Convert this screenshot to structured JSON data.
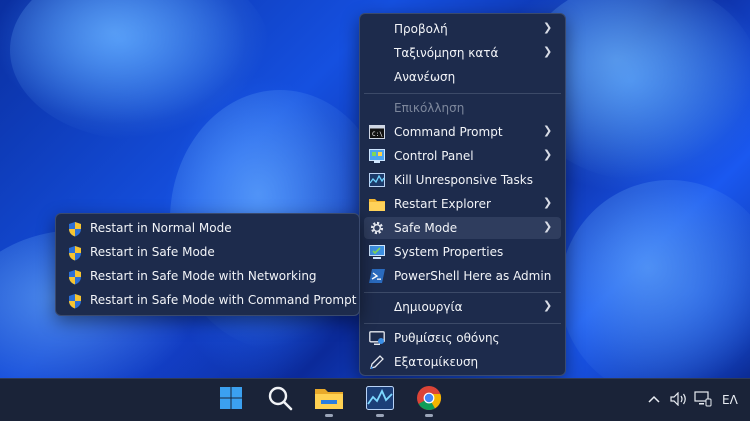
{
  "context_menu": {
    "items": [
      {
        "label": "Προβολή",
        "icon": "none",
        "submenu": true
      },
      {
        "label": "Ταξινόμηση κατά",
        "icon": "none",
        "submenu": true
      },
      {
        "label": "Ανανέωση",
        "icon": "none",
        "submenu": false
      },
      {
        "label": "Επικόλληση",
        "icon": "none",
        "submenu": false,
        "disabled": true
      },
      {
        "label": "Command Prompt",
        "icon": "cmd-icon",
        "submenu": true
      },
      {
        "label": "Control Panel",
        "icon": "control-panel-icon",
        "submenu": true
      },
      {
        "label": "Kill Unresponsive Tasks",
        "icon": "task-manager-icon",
        "submenu": false
      },
      {
        "label": "Restart Explorer",
        "icon": "folder-icon",
        "submenu": true
      },
      {
        "label": "Safe Mode",
        "icon": "gear-icon",
        "submenu": true,
        "highlighted": true
      },
      {
        "label": "System Properties",
        "icon": "system-properties-icon",
        "submenu": false
      },
      {
        "label": "PowerShell Here as Admin",
        "icon": "powershell-icon",
        "submenu": false
      },
      {
        "label": "Δημιουργία",
        "icon": "none",
        "submenu": true
      },
      {
        "label": "Ρυθμίσεις οθόνης",
        "icon": "display-settings-icon",
        "submenu": false
      },
      {
        "label": "Εξατομίκευση",
        "icon": "pen-icon",
        "submenu": false
      }
    ]
  },
  "safe_mode_submenu": {
    "items": [
      {
        "label": "Restart in Normal Mode",
        "icon": "uac-shield-icon"
      },
      {
        "label": "Restart in Safe Mode",
        "icon": "uac-shield-icon"
      },
      {
        "label": "Restart in Safe Mode with Networking",
        "icon": "uac-shield-icon"
      },
      {
        "label": "Restart in Safe Mode with Command Prompt",
        "icon": "uac-shield-icon"
      }
    ]
  },
  "taskbar": {
    "apps": [
      "start-icon",
      "search-icon",
      "file-explorer-icon",
      "task-manager-icon",
      "chrome-icon"
    ],
    "tray": {
      "language": "ΕΛ"
    }
  },
  "colors": {
    "menu_bg": "#1d2b4c",
    "menu_hover": "#2f3d5e",
    "taskbar_bg": "#1a2338",
    "accent": "#3a8ee6"
  }
}
